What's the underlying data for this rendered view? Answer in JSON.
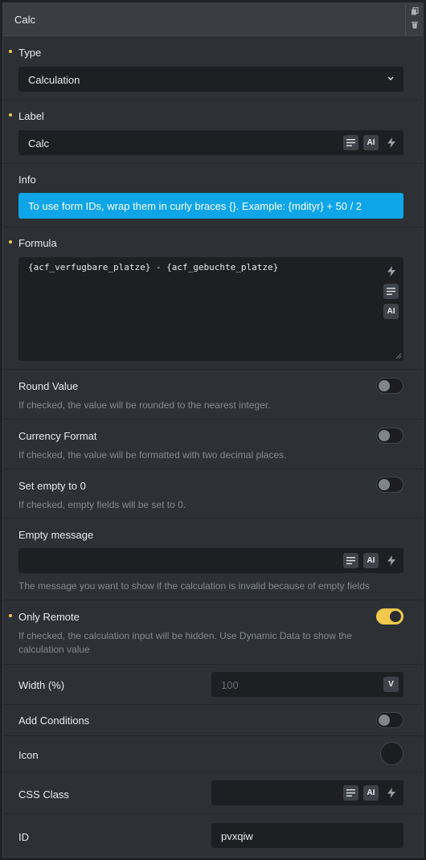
{
  "header": {
    "title": "Calc"
  },
  "type": {
    "label": "Type",
    "value": "Calculation"
  },
  "label_field": {
    "label": "Label",
    "value": "Calc"
  },
  "info": {
    "label": "Info",
    "text": "To use form IDs, wrap them in curly braces {}. Example: {mdityr} + 50 / 2"
  },
  "formula": {
    "label": "Formula",
    "value": "{acf_verfugbare_platze} - {acf_gebuchte_platze}"
  },
  "round_value": {
    "label": "Round Value",
    "hint": "If checked, the value will be rounded to the nearest integer.",
    "checked": false
  },
  "currency_format": {
    "label": "Currency Format",
    "hint": "If checked, the value will be formatted with two decimal places.",
    "checked": false
  },
  "set_empty": {
    "label": "Set empty to 0",
    "hint": "If checked, empty fields will be set to 0.",
    "checked": false
  },
  "empty_message": {
    "label": "Empty message",
    "value": "",
    "hint": "The message you want to show if the calculation is invalid because of empty fields"
  },
  "only_remote": {
    "label": "Only Remote",
    "hint_line1": "If checked, the calculation input will be hidden. Use Dynamic Data to show the",
    "hint_line2": "calculation value",
    "checked": true
  },
  "width": {
    "label": "Width (%)",
    "placeholder": "100",
    "unit_button": "V"
  },
  "add_conditions": {
    "label": "Add Conditions",
    "checked": false
  },
  "icon": {
    "label": "Icon"
  },
  "css_class": {
    "label": "CSS Class",
    "value": ""
  },
  "id_field": {
    "label": "ID",
    "value": "pvxqiw"
  },
  "ai_label": "AI",
  "colors": {
    "accent": "#f2c94c",
    "info": "#0ea5e9",
    "panel": "#2d3034",
    "input": "#1d1f22"
  }
}
